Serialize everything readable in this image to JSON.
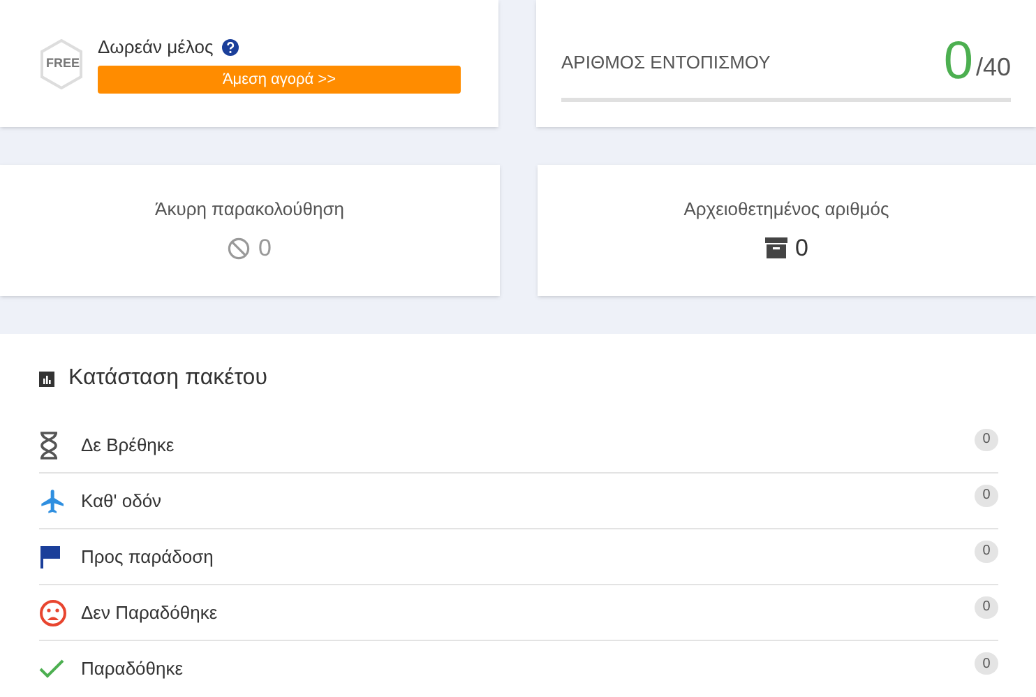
{
  "membership": {
    "badge": "FREE",
    "label": "Δωρεάν μέλος",
    "buy_button": "Άμεση αγορά >>"
  },
  "tracking": {
    "label": "ΑΡΙΘΜΟΣ ΕΝΤΟΠΙΣΜΟΥ",
    "count": "0",
    "limit": "/40",
    "level": 0
  },
  "stats": [
    {
      "label": "Άκυρη παρακολούθηση",
      "kind": "invalid",
      "value": "0"
    },
    {
      "label": "Αρχειοθετημένος αριθμός",
      "kind": "archived",
      "value": "0"
    }
  ],
  "package_status": {
    "title": "Κατάσταση πακέτου",
    "items": [
      {
        "kind": "not_found",
        "label": "Δε Βρέθηκε",
        "count": "0"
      },
      {
        "kind": "in_transit",
        "label": "Καθ' οδόν",
        "count": "0"
      },
      {
        "kind": "out_for_delivery",
        "label": "Προς παράδοση",
        "count": "0"
      },
      {
        "kind": "failed",
        "label": "Δεν Παραδόθηκε",
        "count": "0"
      },
      {
        "kind": "delivered",
        "label": "Παραδόθηκε",
        "count": "0"
      }
    ]
  }
}
